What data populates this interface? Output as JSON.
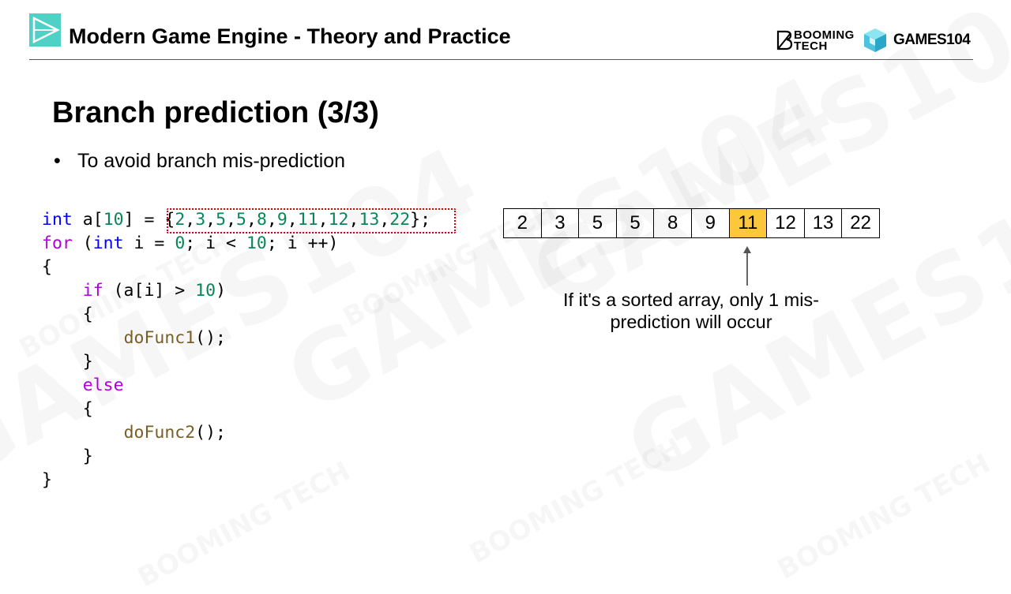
{
  "header": {
    "title": "Modern Game Engine - Theory and Practice",
    "booming_logo_text": "BOOMING\nTECH",
    "games_logo_text": "GAMES104"
  },
  "watermarks": {
    "big": "GAMES104",
    "small": "BOOMING\nTECH"
  },
  "slide": {
    "title": "Branch prediction (3/3)",
    "bullet_marker": "•",
    "bullet_text": "To avoid branch mis-prediction"
  },
  "code": {
    "lines": [
      [
        {
          "t": "int",
          "c": "kw-blue"
        },
        {
          "t": " a[",
          "c": ""
        },
        {
          "t": "10",
          "c": "num"
        },
        {
          "t": "] = {",
          "c": ""
        },
        {
          "t": "2",
          "c": "num"
        },
        {
          "t": ",",
          "c": ""
        },
        {
          "t": "3",
          "c": "num"
        },
        {
          "t": ",",
          "c": ""
        },
        {
          "t": "5",
          "c": "num"
        },
        {
          "t": ",",
          "c": ""
        },
        {
          "t": "5",
          "c": "num"
        },
        {
          "t": ",",
          "c": ""
        },
        {
          "t": "8",
          "c": "num"
        },
        {
          "t": ",",
          "c": ""
        },
        {
          "t": "9",
          "c": "num"
        },
        {
          "t": ",",
          "c": ""
        },
        {
          "t": "11",
          "c": "num"
        },
        {
          "t": ",",
          "c": ""
        },
        {
          "t": "12",
          "c": "num"
        },
        {
          "t": ",",
          "c": ""
        },
        {
          "t": "13",
          "c": "num"
        },
        {
          "t": ",",
          "c": ""
        },
        {
          "t": "22",
          "c": "num"
        },
        {
          "t": "};",
          "c": ""
        }
      ],
      [
        {
          "t": "for",
          "c": "kw-purple"
        },
        {
          "t": " (",
          "c": ""
        },
        {
          "t": "int",
          "c": "kw-blue"
        },
        {
          "t": " i = ",
          "c": ""
        },
        {
          "t": "0",
          "c": "num"
        },
        {
          "t": "; i < ",
          "c": ""
        },
        {
          "t": "10",
          "c": "num"
        },
        {
          "t": "; i ++)",
          "c": ""
        }
      ],
      [
        {
          "t": "{",
          "c": ""
        }
      ],
      [
        {
          "t": "    ",
          "c": ""
        },
        {
          "t": "if",
          "c": "kw-purple"
        },
        {
          "t": " (a[i] > ",
          "c": ""
        },
        {
          "t": "10",
          "c": "num"
        },
        {
          "t": ")",
          "c": ""
        }
      ],
      [
        {
          "t": "    {",
          "c": ""
        }
      ],
      [
        {
          "t": "        ",
          "c": ""
        },
        {
          "t": "doFunc1",
          "c": "fn"
        },
        {
          "t": "();",
          "c": ""
        }
      ],
      [
        {
          "t": "    }",
          "c": ""
        }
      ],
      [
        {
          "t": "    ",
          "c": ""
        },
        {
          "t": "else",
          "c": "kw-purple"
        }
      ],
      [
        {
          "t": "    {",
          "c": ""
        }
      ],
      [
        {
          "t": "        ",
          "c": ""
        },
        {
          "t": "doFunc2",
          "c": "fn"
        },
        {
          "t": "();",
          "c": ""
        }
      ],
      [
        {
          "t": "    }",
          "c": ""
        }
      ],
      [
        {
          "t": "}",
          "c": ""
        }
      ]
    ],
    "highlight_color": "#e0000f"
  },
  "array": {
    "values": [
      "2",
      "3",
      "5",
      "5",
      "8",
      "9",
      "11",
      "12",
      "13",
      "22"
    ],
    "highlight_index": 6,
    "highlight_color": "#fcc73b"
  },
  "caption": "If it's a sorted array, only 1 mis-prediction will occur",
  "colors": {
    "logo_teal": "#4fd1c5",
    "keyword_blue": "#0000ff",
    "keyword_purple": "#af00db",
    "number_green": "#098658",
    "function_brown": "#795e26"
  }
}
